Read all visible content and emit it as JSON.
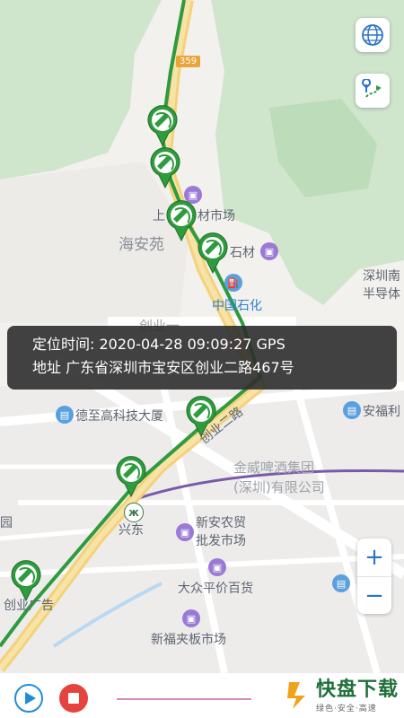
{
  "info": {
    "time_label": "定位时间:",
    "time_value": "2020-04-28 09:09:27",
    "source": "GPS",
    "address_label": "地址",
    "address_value": "广东省深圳市宝安区创业二路467号"
  },
  "map_labels": {
    "road_tag": "359",
    "haian": "海安苑",
    "shangchuan": "上",
    "material_market": "材市场",
    "shicai": "石材",
    "sinopec": "中国石化",
    "chuangye_partial": "创业一",
    "shenzhen_semi": "深圳南\n半导体",
    "dezhi": "德至高科技大厦",
    "anfu": "安福利",
    "chuangye_er": "创业二路",
    "jinwei": "金威啤酒集团\n(深圳)有限公司",
    "xingdong": "兴东",
    "xinan": "新安农贸\n批发市场",
    "dazhong": "大众平价百货",
    "xinfu": "新福夹板市场",
    "chuangye_ad": "创业广告",
    "yuan": "园"
  },
  "controls": {
    "globe_icon": "globe-icon",
    "route_icon": "route-icon",
    "zoom_in": "+",
    "zoom_out": "−"
  },
  "playback": {
    "progress": 0.33
  },
  "watermark": {
    "main": "快盘下载",
    "sub": "绿色·安全·高速"
  },
  "colors": {
    "track": "#2e9b3c",
    "marker": "#2e9b3c",
    "play": "#1e8fd6",
    "stop": "#e4443d",
    "info_bg": "#2d2d2d"
  }
}
